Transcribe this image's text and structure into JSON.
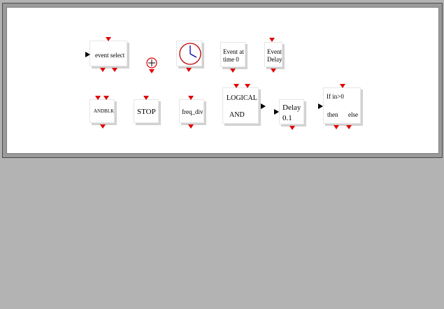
{
  "colors": {
    "port": "#e00000",
    "window_bg": "#b3b3b3",
    "canvas_bg": "#ffffff"
  },
  "blocks": {
    "event_select": "event select",
    "event_at_time_0": [
      "Event at",
      "time 0"
    ],
    "event_delay": [
      "Event",
      "Delay"
    ],
    "andblk": "ANDBLK",
    "stop": "STOP",
    "freq_div": "freq_div",
    "logical_and": [
      "LOGICAL",
      "AND"
    ],
    "delay": [
      "Delay",
      "0.1"
    ],
    "if_then_else": {
      "line1": "If in>0",
      "then": "then",
      "else": "else"
    }
  }
}
